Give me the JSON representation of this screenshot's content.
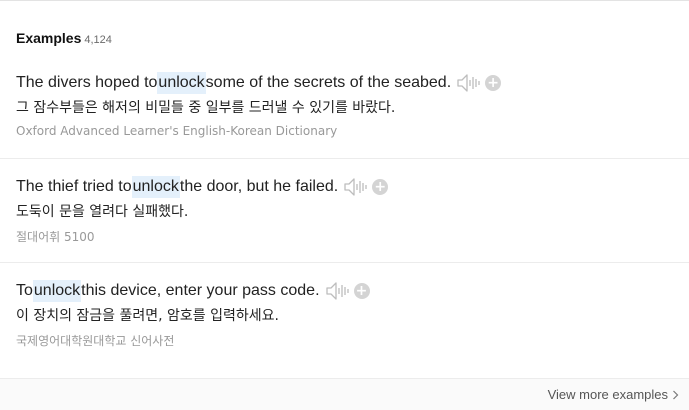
{
  "header": {
    "title": "Examples",
    "count": "4,124"
  },
  "examples": [
    {
      "before": "The divers hoped to ",
      "keyword": "unlock",
      "after": " some of the secrets of the seabed.",
      "translation": "그 잠수부들은 해저의 비밀들 중 일부를 드러낼 수 있기를 바랐다.",
      "source": "Oxford Advanced Learner's English-Korean Dictionary"
    },
    {
      "before": "The thief tried to ",
      "keyword": "unlock",
      "after": " the door, but he failed.",
      "translation": "도둑이 문을 열려다 실패했다.",
      "source": "절대어휘 5100"
    },
    {
      "before": "To ",
      "keyword": "unlock",
      "after": " this device, enter your pass code.",
      "translation": "이 장치의 잠금을 풀려면, 암호를 입력하세요.",
      "source": "국제영어대학원대학교 신어사전"
    }
  ],
  "icons": {
    "speaker": "speaker-icon",
    "add": "plus-circle-icon",
    "chevron": "chevron-right-icon"
  },
  "colors": {
    "highlight": "#e4f0fb",
    "icon_gray": "#bdbdbd"
  },
  "footer": {
    "view_more": "View more examples"
  }
}
